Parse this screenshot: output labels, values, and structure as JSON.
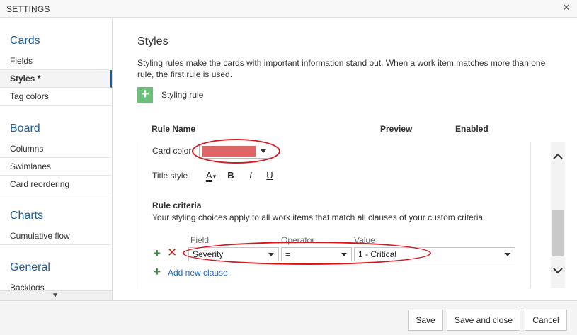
{
  "window": {
    "title": "SETTINGS",
    "close_glyph": "✕"
  },
  "sidebar": {
    "sections": [
      {
        "title": "Cards",
        "items": [
          {
            "label": "Fields"
          },
          {
            "label": "Styles *",
            "active": true
          },
          {
            "label": "Tag colors"
          }
        ]
      },
      {
        "title": "Board",
        "items": [
          {
            "label": "Columns"
          },
          {
            "label": "Swimlanes"
          },
          {
            "label": "Card reordering"
          }
        ]
      },
      {
        "title": "Charts",
        "items": [
          {
            "label": "Cumulative flow"
          }
        ]
      },
      {
        "title": "General",
        "items": [
          {
            "label": "Backlogs"
          }
        ]
      }
    ],
    "scroll_down_glyph": "▼"
  },
  "main": {
    "title": "Styles",
    "description": "Styling rules make the cards with important information stand out. When a work item matches more than one rule, the first rule is used.",
    "add_rule_glyph": "+",
    "add_rule_label": "Styling rule",
    "columns": {
      "rule_name": "Rule Name",
      "preview": "Preview",
      "enabled": "Enabled"
    },
    "rule": {
      "card_color_label": "Card color",
      "card_color_value": "#e06666",
      "title_style_label": "Title style",
      "format_buttons": {
        "font_color": "A",
        "bold": "B",
        "italic": "I",
        "underline": "U"
      }
    },
    "criteria": {
      "title": "Rule criteria",
      "description": "Your styling choices apply to all work items that match all clauses of your custom criteria.",
      "headers": {
        "field": "Field",
        "operator": "Operator",
        "value": "Value"
      },
      "clause": {
        "field": "Severity",
        "operator": "=",
        "value": "1 - Critical"
      },
      "add_glyph": "+",
      "delete_glyph": "✕",
      "add_clause_label": "Add new clause"
    }
  },
  "footer": {
    "save": "Save",
    "save_close": "Save and close",
    "cancel": "Cancel"
  },
  "colors": {
    "accent": "#1b5e9e",
    "add_green": "#6cbf7a",
    "annotation_red": "#d9141c"
  }
}
